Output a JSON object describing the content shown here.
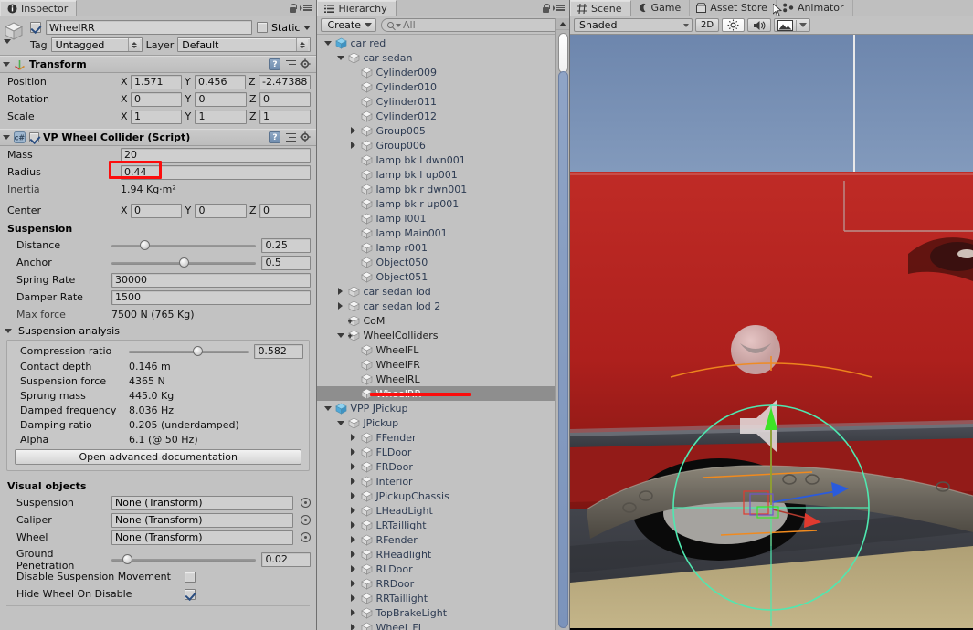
{
  "inspector": {
    "tab": "Inspector",
    "tab_icon": "info-icon",
    "object": {
      "name": "WheelRR",
      "enabled": true,
      "static_label": "Static",
      "static_checked": false,
      "tag_label": "Tag",
      "tag_value": "Untagged",
      "layer_label": "Layer",
      "layer_value": "Default"
    },
    "transform": {
      "title": "Transform",
      "rows": [
        {
          "label": "Position",
          "x": "1.571",
          "y": "0.456",
          "z": "-2.47388"
        },
        {
          "label": "Rotation",
          "x": "0",
          "y": "0",
          "z": "0"
        },
        {
          "label": "Scale",
          "x": "1",
          "y": "1",
          "z": "1"
        }
      ],
      "axis": [
        "X",
        "Y",
        "Z"
      ]
    },
    "wheel_collider": {
      "title": "VP Wheel Collider (Script)",
      "enabled": true,
      "mass_label": "Mass",
      "mass_value": "20",
      "radius_label": "Radius",
      "radius_value": "0.44",
      "inertia_label": "Inertia",
      "inertia_value": "1.94 Kg·m²",
      "center_label": "Center",
      "center_x": "0",
      "center_y": "0",
      "center_z": "0",
      "suspension_title": "Suspension",
      "distance_label": "Distance",
      "distance_value": "0.25",
      "distance_pct": 21,
      "anchor_label": "Anchor",
      "anchor_value": "0.5",
      "anchor_pct": 50,
      "spring_rate_label": "Spring Rate",
      "spring_rate_value": "30000",
      "damper_rate_label": "Damper Rate",
      "damper_rate_value": "1500",
      "max_force_label": "Max force",
      "max_force_value": "7500 N  (765 Kg)",
      "analysis_title": "Suspension analysis",
      "compression_label": "Compression ratio",
      "compression_value": "0.582",
      "compression_pct": 58,
      "analysis_rows": [
        {
          "label": "Contact depth",
          "value": "0.146 m"
        },
        {
          "label": "Suspension force",
          "value": "4365 N"
        },
        {
          "label": "Sprung mass",
          "value": "445.0 Kg"
        },
        {
          "label": "Damped frequency",
          "value": "8.036 Hz"
        },
        {
          "label": "Damping ratio",
          "value": "0.205 (underdamped)"
        },
        {
          "label": "Alpha",
          "value": "6.1 (@ 50 Hz)"
        }
      ],
      "doc_button": "Open advanced documentation",
      "visual_title": "Visual objects",
      "visual_rows": [
        {
          "label": "Suspension",
          "value": "None (Transform)"
        },
        {
          "label": "Caliper",
          "value": "None (Transform)"
        },
        {
          "label": "Wheel",
          "value": "None (Transform)"
        }
      ],
      "ground_pen_label": "Ground Penetration",
      "ground_pen_value": "0.02",
      "ground_pen_pct": 8,
      "disable_susp_label": "Disable Suspension Movement",
      "disable_susp_checked": false,
      "hide_wheel_label": "Hide Wheel On Disable",
      "hide_wheel_checked": true
    }
  },
  "hierarchy": {
    "tab": "Hierarchy",
    "create_label": "Create",
    "search_placeholder": "All",
    "items": [
      {
        "label": "car red",
        "indent": 0,
        "arrow": "down",
        "icon": "prefab",
        "chevron": true
      },
      {
        "label": "car sedan",
        "indent": 1,
        "arrow": "down",
        "icon": "cube"
      },
      {
        "label": "Cylinder009",
        "indent": 2,
        "arrow": "none",
        "icon": "cube"
      },
      {
        "label": "Cylinder010",
        "indent": 2,
        "arrow": "none",
        "icon": "cube"
      },
      {
        "label": "Cylinder011",
        "indent": 2,
        "arrow": "none",
        "icon": "cube"
      },
      {
        "label": "Cylinder012",
        "indent": 2,
        "arrow": "none",
        "icon": "cube"
      },
      {
        "label": "Group005",
        "indent": 2,
        "arrow": "right",
        "icon": "cube"
      },
      {
        "label": "Group006",
        "indent": 2,
        "arrow": "right",
        "icon": "cube"
      },
      {
        "label": "lamp bk l dwn001",
        "indent": 2,
        "arrow": "none",
        "icon": "cube"
      },
      {
        "label": "lamp bk l up001",
        "indent": 2,
        "arrow": "none",
        "icon": "cube"
      },
      {
        "label": "lamp bk r dwn001",
        "indent": 2,
        "arrow": "none",
        "icon": "cube"
      },
      {
        "label": "lamp bk r up001",
        "indent": 2,
        "arrow": "none",
        "icon": "cube"
      },
      {
        "label": "lamp l001",
        "indent": 2,
        "arrow": "none",
        "icon": "cube"
      },
      {
        "label": "lamp Main001",
        "indent": 2,
        "arrow": "none",
        "icon": "cube"
      },
      {
        "label": "lamp r001",
        "indent": 2,
        "arrow": "none",
        "icon": "cube"
      },
      {
        "label": "Object050",
        "indent": 2,
        "arrow": "none",
        "icon": "cube"
      },
      {
        "label": "Object051",
        "indent": 2,
        "arrow": "none",
        "icon": "cube"
      },
      {
        "label": "car sedan lod",
        "indent": 1,
        "arrow": "right",
        "icon": "cube"
      },
      {
        "label": "car sedan lod 2",
        "indent": 1,
        "arrow": "right",
        "icon": "cube"
      },
      {
        "label": "CoM",
        "indent": 1,
        "arrow": "none",
        "icon": "cube-plus",
        "dark": true
      },
      {
        "label": "WheelColliders",
        "indent": 1,
        "arrow": "down",
        "icon": "cube-plus",
        "dark": true
      },
      {
        "label": "WheelFL",
        "indent": 2,
        "arrow": "none",
        "icon": "cube",
        "dark": true
      },
      {
        "label": "WheelFR",
        "indent": 2,
        "arrow": "none",
        "icon": "cube",
        "dark": true
      },
      {
        "label": "WheelRL",
        "indent": 2,
        "arrow": "none",
        "icon": "cube",
        "dark": true
      },
      {
        "label": "WheelRR",
        "indent": 2,
        "arrow": "none",
        "icon": "cube",
        "selected": true
      },
      {
        "label": "VPP JPickup",
        "indent": 0,
        "arrow": "down",
        "icon": "prefab",
        "chevron": true
      },
      {
        "label": "JPickup",
        "indent": 1,
        "arrow": "down",
        "icon": "cube"
      },
      {
        "label": "FFender",
        "indent": 2,
        "arrow": "right",
        "icon": "cube"
      },
      {
        "label": "FLDoor",
        "indent": 2,
        "arrow": "right",
        "icon": "cube"
      },
      {
        "label": "FRDoor",
        "indent": 2,
        "arrow": "right",
        "icon": "cube"
      },
      {
        "label": "Interior",
        "indent": 2,
        "arrow": "right",
        "icon": "cube"
      },
      {
        "label": "JPickupChassis",
        "indent": 2,
        "arrow": "right",
        "icon": "cube"
      },
      {
        "label": "LHeadLight",
        "indent": 2,
        "arrow": "right",
        "icon": "cube"
      },
      {
        "label": "LRTaillight",
        "indent": 2,
        "arrow": "right",
        "icon": "cube"
      },
      {
        "label": "RFender",
        "indent": 2,
        "arrow": "right",
        "icon": "cube"
      },
      {
        "label": "RHeadlight",
        "indent": 2,
        "arrow": "right",
        "icon": "cube"
      },
      {
        "label": "RLDoor",
        "indent": 2,
        "arrow": "right",
        "icon": "cube"
      },
      {
        "label": "RRDoor",
        "indent": 2,
        "arrow": "right",
        "icon": "cube"
      },
      {
        "label": "RRTaillight",
        "indent": 2,
        "arrow": "right",
        "icon": "cube"
      },
      {
        "label": "TopBrakeLight",
        "indent": 2,
        "arrow": "right",
        "icon": "cube"
      },
      {
        "label": "Wheel_FL",
        "indent": 2,
        "arrow": "right",
        "icon": "cube"
      }
    ]
  },
  "scene": {
    "tabs": [
      {
        "label": "Scene",
        "icon": "grid-icon",
        "active": true
      },
      {
        "label": "Game",
        "icon": "gamepad-icon",
        "active": false
      },
      {
        "label": "Asset Store",
        "icon": "store-icon",
        "active": false
      },
      {
        "label": "Animator",
        "icon": "animator-icon",
        "active": false
      }
    ],
    "toolbar": {
      "draw_mode": "Shaded",
      "two_d": "2D",
      "lighting_icon": "sun-icon",
      "audio_icon": "speaker-icon",
      "effects_icon": "image-icon"
    },
    "gizmo": {
      "light_icon": "light-gizmo-icon",
      "audio_icon": "audio-gizmo-icon",
      "wheel_circle_color": "#4fe8b0",
      "x_axis_color": "#e03a2f",
      "y_axis_color": "#3ee326",
      "z_axis_color": "#2a5bdd",
      "suspension_color": "#f08a1e"
    },
    "colors": {
      "sky_top": "#6d86ad",
      "sky_bottom": "#a8bdd6",
      "car_body": "#b52323",
      "road": "#3e4148",
      "shoulder": "#b9a97c"
    }
  }
}
